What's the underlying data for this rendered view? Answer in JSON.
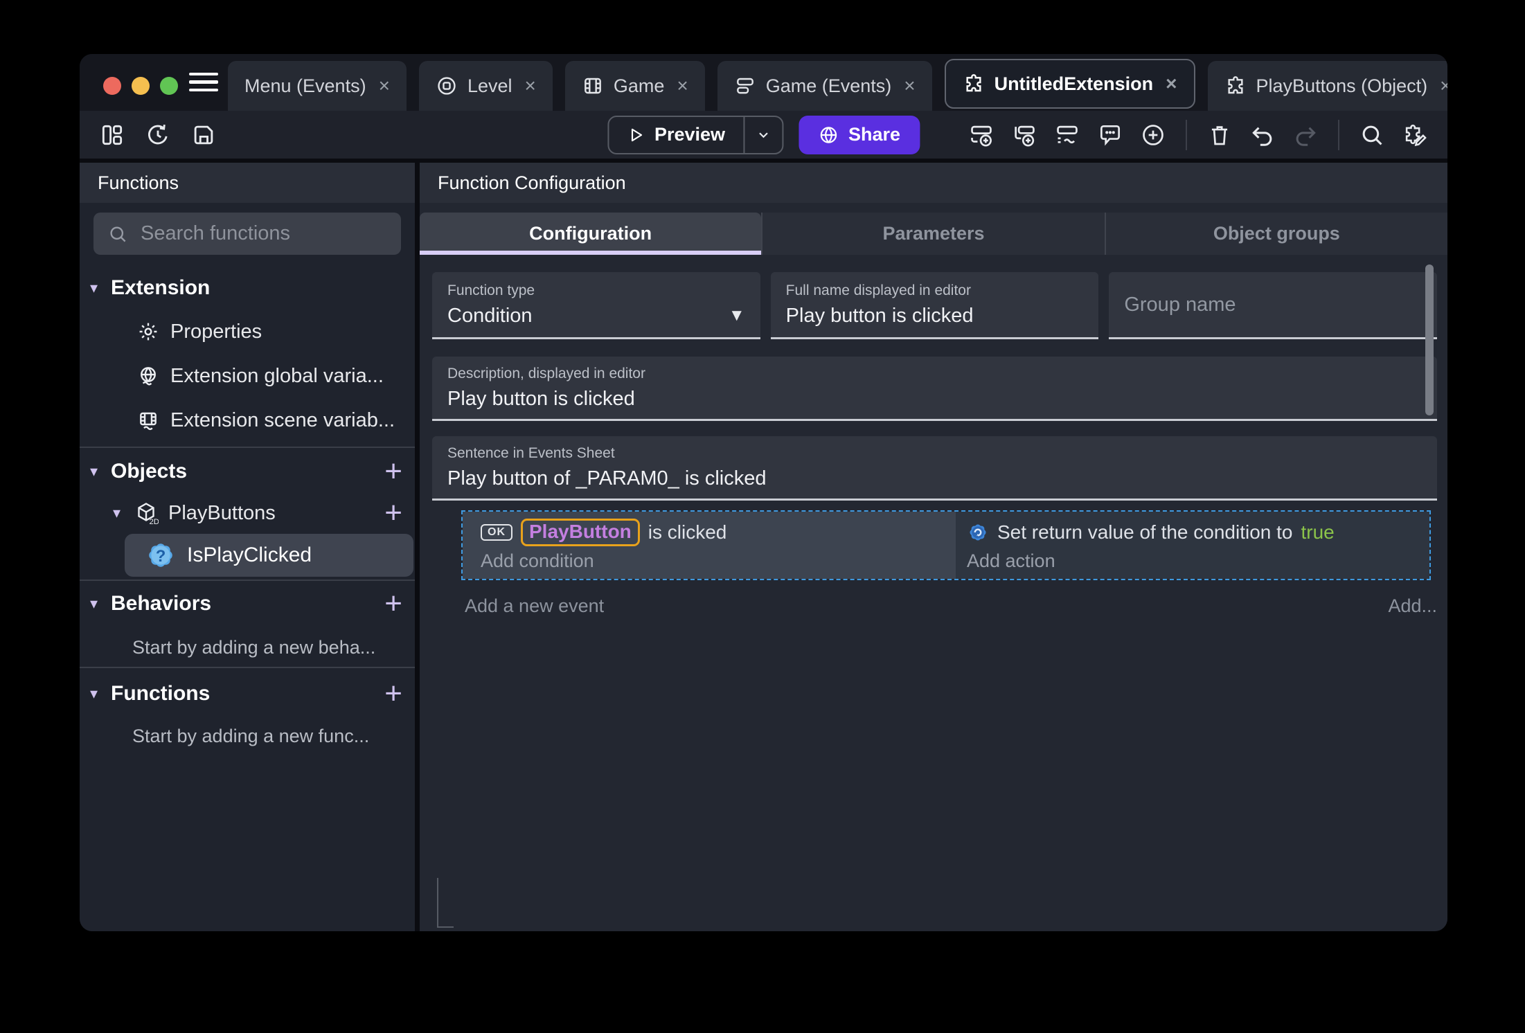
{
  "window": {
    "tabs": [
      {
        "label": "Menu (Events)",
        "close": "×"
      },
      {
        "label": "Level",
        "close": "×"
      },
      {
        "label": "Game",
        "close": "×"
      },
      {
        "label": "Game (Events)",
        "close": "×"
      },
      {
        "label": "UntitledExtension",
        "close": "×"
      },
      {
        "label": "PlayButtons (Object)",
        "close": "×"
      }
    ]
  },
  "toolbar": {
    "preview_label": "Preview",
    "share_label": "Share"
  },
  "sidebar": {
    "title": "Functions",
    "search_placeholder": "Search functions",
    "extension_section": {
      "label": "Extension",
      "items": [
        {
          "label": "Properties"
        },
        {
          "label": "Extension global varia..."
        },
        {
          "label": "Extension scene variab..."
        }
      ]
    },
    "objects_section": {
      "label": "Objects",
      "object": {
        "label": "PlayButtons",
        "badge": "2D"
      },
      "function": {
        "label": "IsPlayClicked",
        "icon_glyph": "?"
      }
    },
    "behaviors_section": {
      "label": "Behaviors",
      "empty_hint": "Start by adding a new beha..."
    },
    "functions_section": {
      "label": "Functions",
      "empty_hint": "Start by adding a new func..."
    }
  },
  "main": {
    "title": "Function Configuration",
    "tabs": [
      {
        "label": "Configuration"
      },
      {
        "label": "Parameters"
      },
      {
        "label": "Object groups"
      }
    ],
    "form": {
      "function_type": {
        "label": "Function type",
        "value": "Condition"
      },
      "full_name": {
        "label": "Full name displayed in editor",
        "value": "Play button is clicked"
      },
      "group_name": {
        "placeholder": "Group name"
      },
      "description": {
        "label": "Description, displayed in editor",
        "value": "Play button is clicked"
      },
      "sentence": {
        "label": "Sentence in Events Sheet",
        "value": "Play button of _PARAM0_ is clicked"
      }
    },
    "events": {
      "condition": {
        "badge": "OK",
        "object": "PlayButton",
        "text": "is clicked",
        "add_label": "Add condition"
      },
      "action": {
        "text": "Set return value of the condition to",
        "value": "true",
        "add_label": "Add action"
      },
      "add_event_label": "Add a new event",
      "add_button_label": "Add..."
    }
  },
  "colors": {
    "accent_purple": "#5a2fe0",
    "selection_blue": "#3f9ae0",
    "object_chip_text": "#c47fe0",
    "object_chip_border": "#e8a21c",
    "boolean_true_green": "#8bc34a",
    "accent_lavender": "#cfc2ee"
  }
}
